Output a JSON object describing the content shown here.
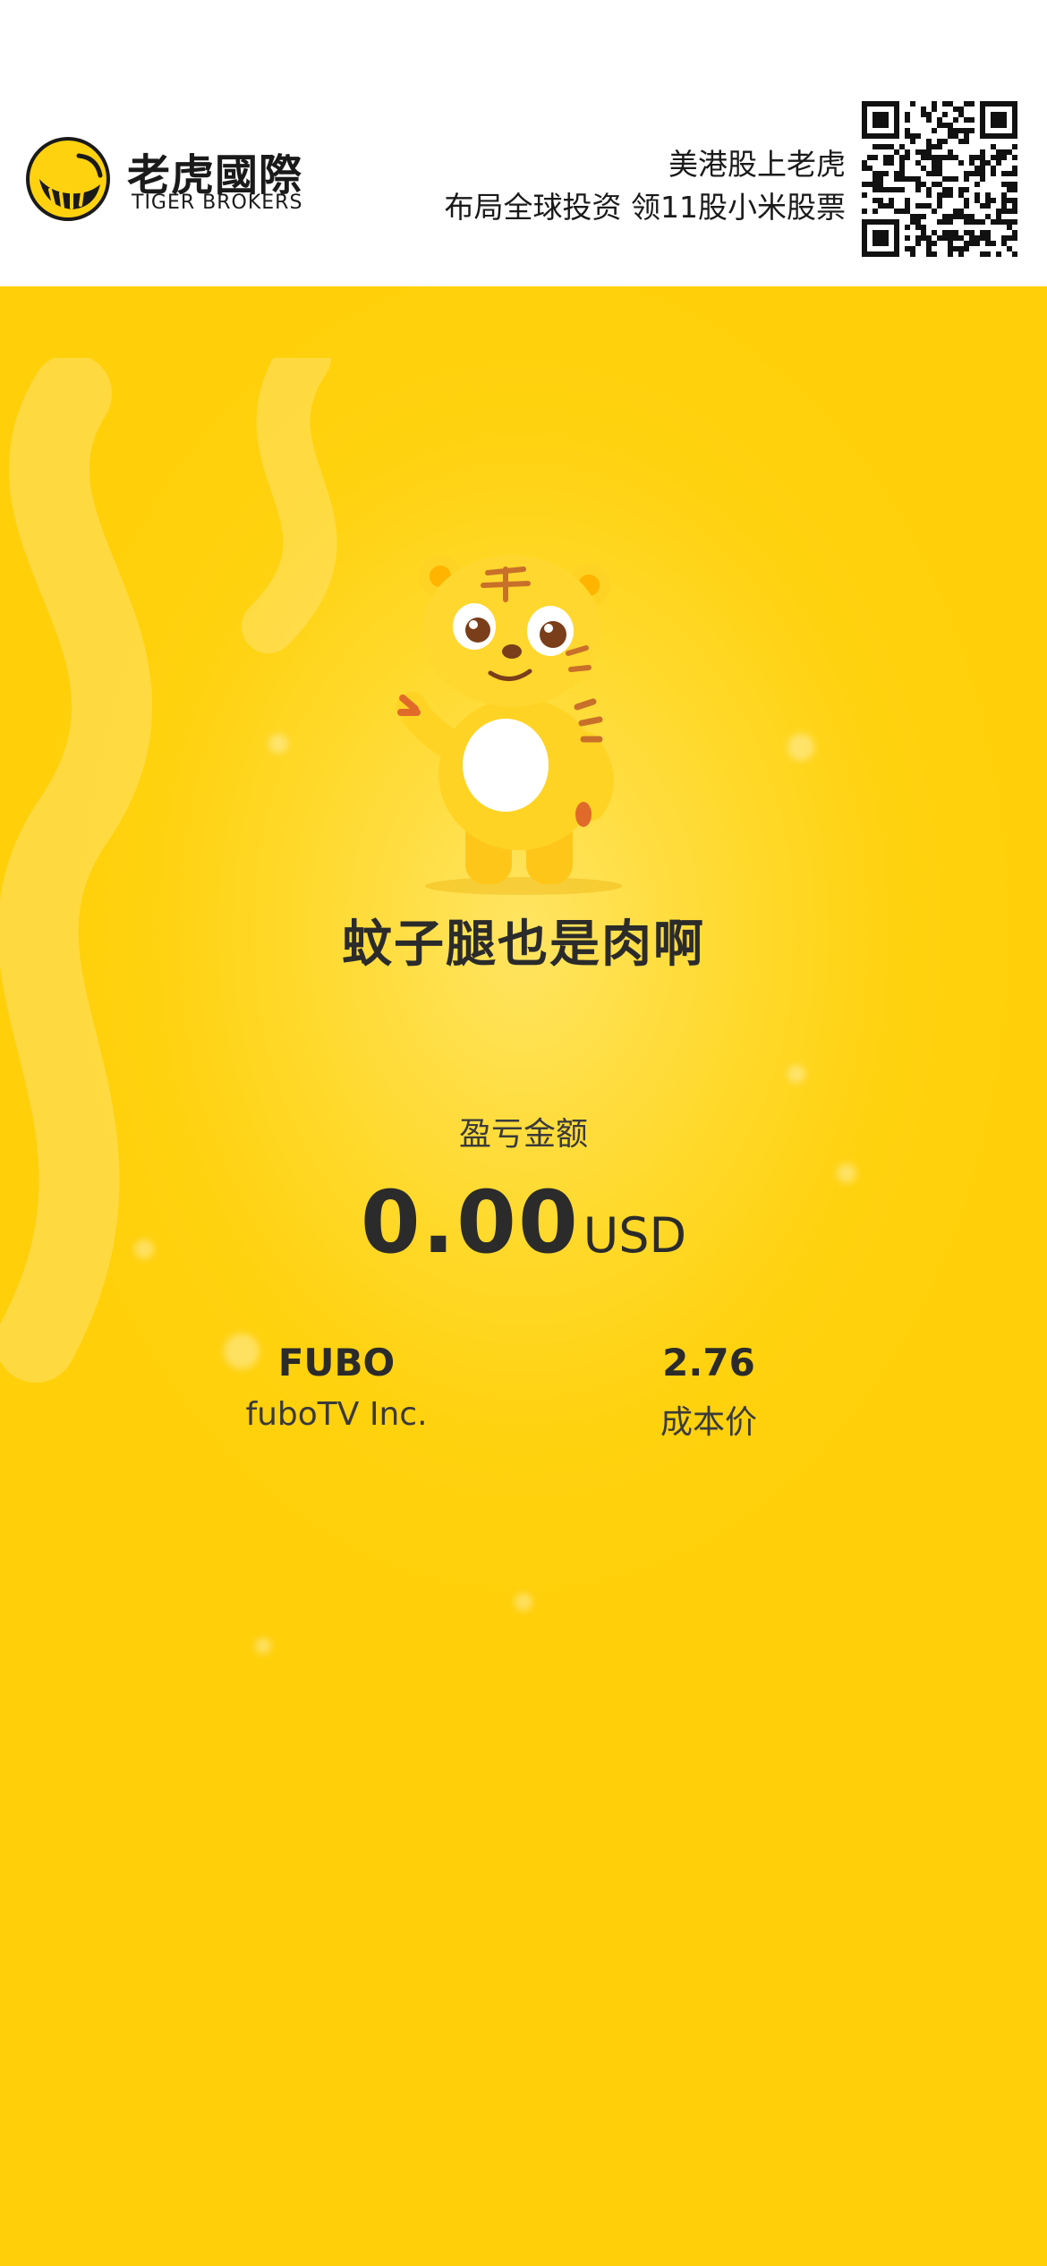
{
  "header": {
    "brand_cn": "老虎國際",
    "brand_en": "TIGER BROKERS",
    "promo_line1": "美港股上老虎",
    "promo_line2": "布局全球投资 领11股小米股票",
    "qr_icon": "qr-code-icon",
    "logo_icon": "tiger-logo-icon"
  },
  "card": {
    "mascot_icon": "tiger-mascot-icon",
    "slogan": "蚊子腿也是肉啊",
    "pl_label": "盈亏金额",
    "pl_value": "0.00",
    "pl_unit": "USD",
    "ticker": "FUBO",
    "company": "fuboTV Inc.",
    "cost_value": "2.76",
    "cost_label": "成本价"
  },
  "colors": {
    "brand_yellow": "#FFD20F",
    "text_dark": "#2B2B2B"
  }
}
